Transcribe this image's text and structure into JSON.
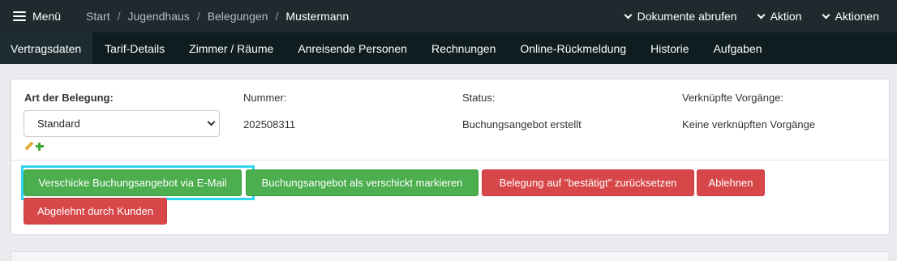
{
  "topbar": {
    "menu_label": "Menü",
    "breadcrumb": [
      "Start",
      "Jugendhaus",
      "Belegungen",
      "Mustermann"
    ],
    "breadcrumb_sep": "/",
    "actions": [
      "Dokumente abrufen",
      "Aktion",
      "Aktionen"
    ]
  },
  "tabs": [
    "Vertragsdaten",
    "Tarif-Details",
    "Zimmer / Räume",
    "Anreisende Personen",
    "Rechnungen",
    "Online-Rückmeldung",
    "Historie",
    "Aufgaben"
  ],
  "active_tab": "Vertragsdaten",
  "fields": {
    "art": {
      "label": "Art der Belegung:",
      "value": "Standard"
    },
    "nummer": {
      "label": "Nummer:",
      "value": "202508311"
    },
    "status": {
      "label": "Status:",
      "value": "Buchungsangebot erstellt"
    },
    "vorgaenge": {
      "label": "Verknüpfte Vorgänge:",
      "value": "Keine verknüpften Vorgänge"
    }
  },
  "buttons": {
    "send_email": "Verschicke Buchungsangebot via E-Mail",
    "mark_sent": "Buchungsangebot als verschickt markieren",
    "reset_confirmed": "Belegung auf \"bestätigt\" zurücksetzen",
    "reject": "Ablehnen",
    "rejected_by_customer": "Abgelehnt durch Kunden"
  },
  "colors": {
    "topbar": "#1f2a2f",
    "tabbar": "#0f1c20",
    "green": "#4cae4f",
    "red": "#d74649",
    "focus": "#2fd6f0"
  },
  "icons": [
    "hamburger-icon",
    "chevron-down-icon",
    "pencil-icon",
    "plus-icon"
  ]
}
